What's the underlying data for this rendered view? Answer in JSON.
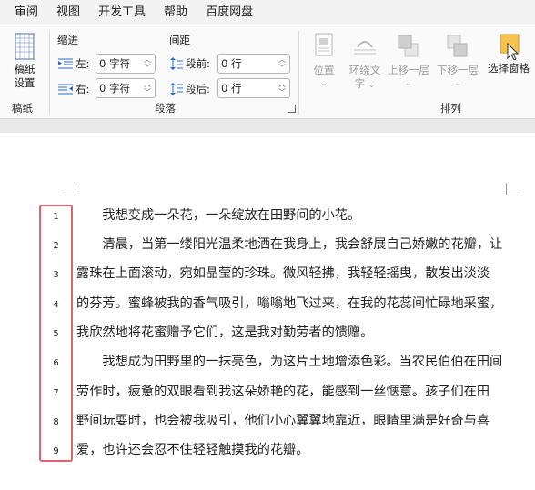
{
  "menu": [
    "审阅",
    "视图",
    "开发工具",
    "帮助",
    "百度网盘"
  ],
  "ribbon": {
    "page_setup": {
      "button": "稿纸设置",
      "line1": "稿纸",
      "line2": "设置",
      "group": "稿纸"
    },
    "paragraph": {
      "indent_title": "缩进",
      "spacing_title": "间距",
      "left_label": "左:",
      "right_label": "右:",
      "before_label": "段前:",
      "after_label": "段后:",
      "left_value": "0 字符",
      "right_value": "0 字符",
      "before_value": "0 行",
      "after_value": "0 行",
      "group": "段落"
    },
    "arrange": {
      "position": "位置",
      "wrap_line1": "环绕文",
      "wrap_line2": "字",
      "bring_forward": "上移一层",
      "send_backward": "下移一层",
      "selection_pane": "选择窗格",
      "group": "排列"
    }
  },
  "document": {
    "line_numbers": [
      "1",
      "2",
      "3",
      "4",
      "5",
      "6",
      "7",
      "8",
      "9"
    ],
    "lines": [
      "　　我想变成一朵花，一朵绽放在田野间的小花。",
      "　　清晨，当第一缕阳光温柔地洒在我身上，我会舒展自己娇嫩的花瓣，让",
      "露珠在上面滚动，宛如晶莹的珍珠。微风轻拂，我轻轻摇曳，散发出淡淡",
      "的芬芳。蜜蜂被我的香气吸引，嗡嗡地飞过来，在我的花蕊间忙碌地采蜜，",
      "我欣然地将花蜜赠予它们，这是我对勤劳者的馈赠。",
      "　　我想成为田野里的一抹亮色，为这片土地增添色彩。当农民伯伯在田间",
      "劳作时，疲惫的双眼看到我这朵娇艳的花，能感到一丝惬意。孩子们在田",
      "野间玩耍时，也会被我吸引，他们小心翼翼地靠近，眼睛里满是好奇与喜",
      "爱，也许还会忍不住轻轻触摸我的花瓣。"
    ]
  },
  "colors": {
    "line_number_box": "#e06470",
    "selection_pane_icon": "#f5c44e"
  }
}
